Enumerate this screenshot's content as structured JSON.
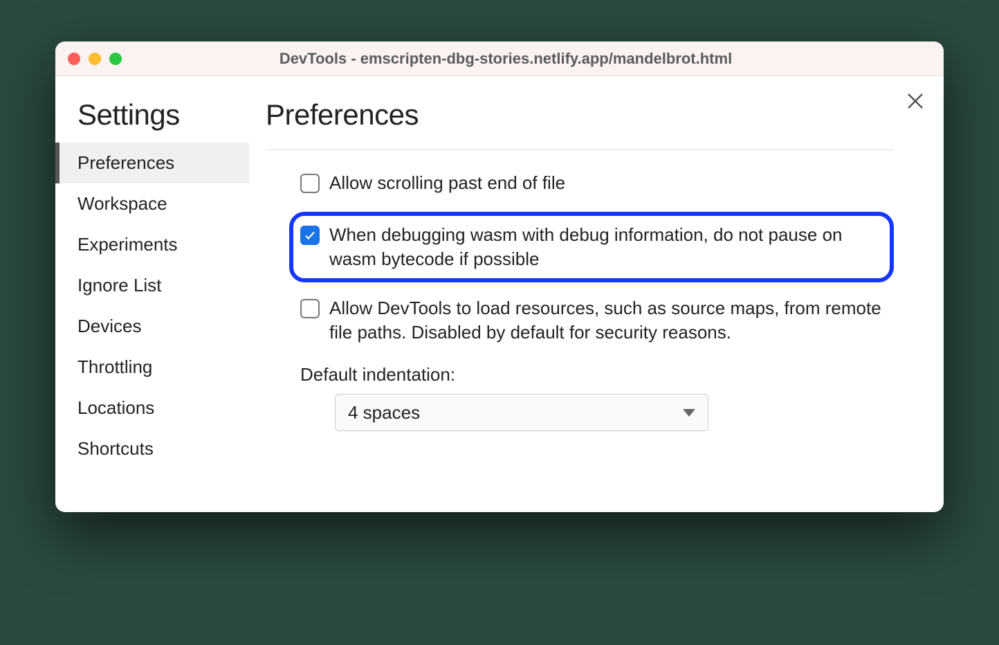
{
  "window": {
    "title": "DevTools - emscripten-dbg-stories.netlify.app/mandelbrot.html"
  },
  "sidebar": {
    "title": "Settings",
    "items": [
      {
        "label": "Preferences",
        "active": true
      },
      {
        "label": "Workspace",
        "active": false
      },
      {
        "label": "Experiments",
        "active": false
      },
      {
        "label": "Ignore List",
        "active": false
      },
      {
        "label": "Devices",
        "active": false
      },
      {
        "label": "Throttling",
        "active": false
      },
      {
        "label": "Locations",
        "active": false
      },
      {
        "label": "Shortcuts",
        "active": false
      }
    ]
  },
  "main": {
    "title": "Preferences",
    "options": [
      {
        "label": "Allow scrolling past end of file",
        "checked": false,
        "highlight": false
      },
      {
        "label": "When debugging wasm with debug information, do not pause on wasm bytecode if possible",
        "checked": true,
        "highlight": true
      },
      {
        "label": "Allow DevTools to load resources, such as source maps, from remote file paths. Disabled by default for security reasons.",
        "checked": false,
        "highlight": false
      }
    ],
    "indentation": {
      "label": "Default indentation:",
      "value": "4 spaces"
    }
  }
}
